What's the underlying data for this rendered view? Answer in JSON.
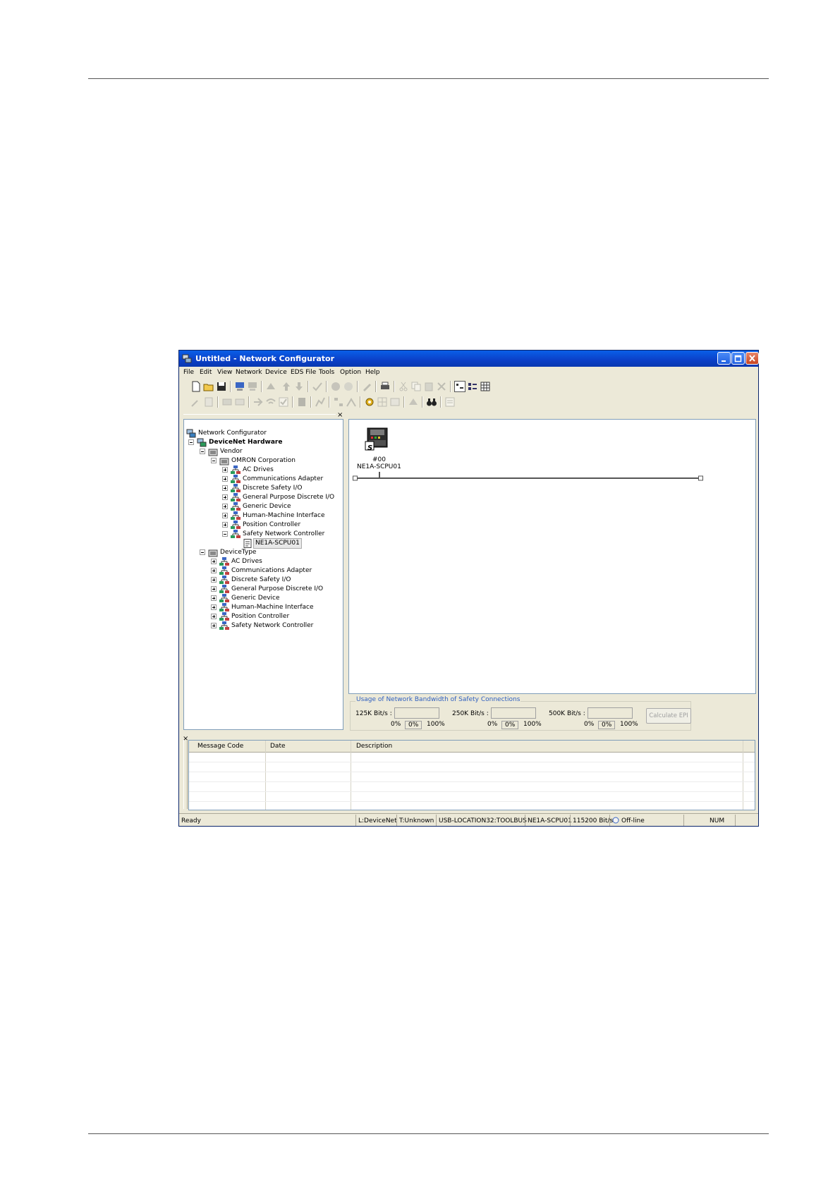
{
  "window": {
    "title": "Untitled - Network Configurator"
  },
  "menu": [
    "File",
    "Edit",
    "View",
    "Network",
    "Device",
    "EDS File",
    "Tools",
    "Option",
    "Help"
  ],
  "tree": {
    "root": "Network Configurator",
    "hardware": "DeviceNet Hardware",
    "vendor": "Vendor",
    "omron": "OMRON Corporation",
    "vendor_items": [
      "AC Drives",
      "Communications Adapter",
      "Discrete Safety I/O",
      "General Purpose Discrete I/O",
      "Generic Device",
      "Human-Machine Interface",
      "Position Controller",
      "Safety Network Controller"
    ],
    "selected_device": "NE1A-SCPU01",
    "devicetype": "DeviceType",
    "devicetype_items": [
      "AC Drives",
      "Communications Adapter",
      "Discrete Safety I/O",
      "General Purpose Discrete I/O",
      "Generic Device",
      "Human-Machine Interface",
      "Position Controller",
      "Safety Network Controller"
    ]
  },
  "network": {
    "node_address": "#00",
    "node_name": "NE1A-SCPU01",
    "node_badge": "S"
  },
  "bandwidth": {
    "title": "Usage of Network Bandwidth of Safety Connections",
    "rates": [
      "125K Bit/s :",
      "250K Bit/s :",
      "500K Bit/s :"
    ],
    "min_label": "0%",
    "value_label": "0%",
    "max_label": "100%",
    "calc_button": "Calculate EPI"
  },
  "log": {
    "columns": [
      "Message Code",
      "Date",
      "Description"
    ]
  },
  "status": {
    "ready": "Ready",
    "network": "L:DeviceNet",
    "type": "T:Unknown",
    "port": "USB-LOCATION32:TOOLBUS",
    "device": "NE1A-SCPU01",
    "baud": "115200 Bit/s",
    "mode": "Off-line",
    "num": "NUM"
  },
  "colors": {
    "titlebar": "#0b3fc7",
    "chrome": "#ece9d8",
    "accent_text": "#3060c0"
  }
}
